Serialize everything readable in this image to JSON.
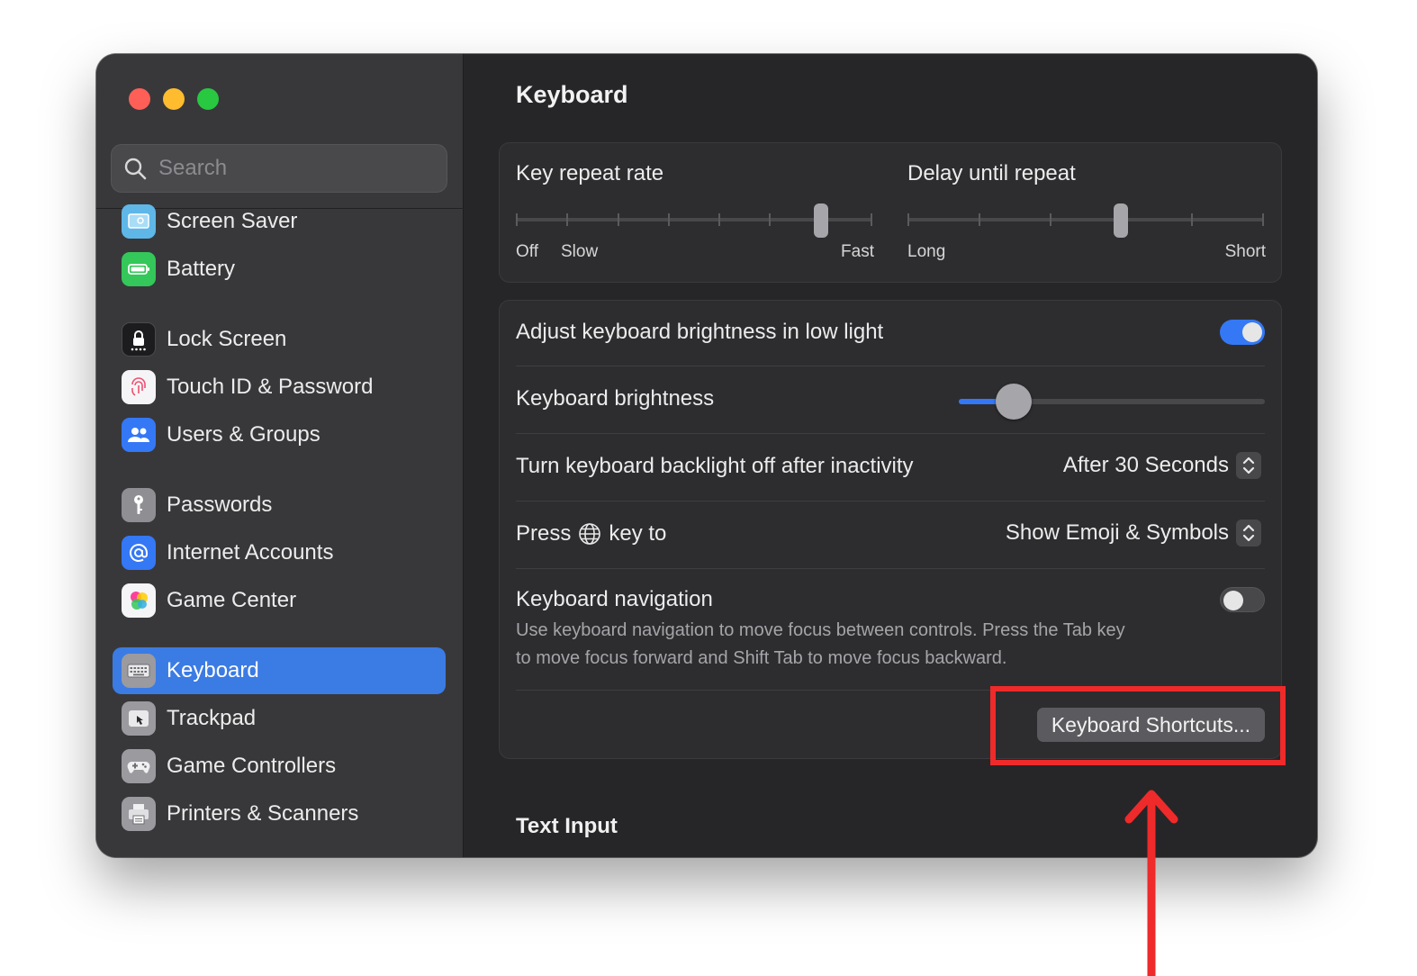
{
  "search": {
    "placeholder": "Search"
  },
  "sidebar": {
    "items": [
      {
        "label": "Screen Saver",
        "icon": "screen-saver-icon"
      },
      {
        "label": "Battery",
        "icon": "battery-icon"
      },
      {
        "label": "Lock Screen",
        "icon": "lock-icon"
      },
      {
        "label": "Touch ID & Password",
        "icon": "fingerprint-icon"
      },
      {
        "label": "Users & Groups",
        "icon": "users-icon"
      },
      {
        "label": "Passwords",
        "icon": "key-icon"
      },
      {
        "label": "Internet Accounts",
        "icon": "at-sign-icon"
      },
      {
        "label": "Game Center",
        "icon": "game-center-icon"
      },
      {
        "label": "Keyboard",
        "icon": "keyboard-icon",
        "selected": true
      },
      {
        "label": "Trackpad",
        "icon": "trackpad-icon"
      },
      {
        "label": "Game Controllers",
        "icon": "gamepad-icon"
      },
      {
        "label": "Printers & Scanners",
        "icon": "printer-icon"
      }
    ]
  },
  "main": {
    "title": "Keyboard",
    "key_repeat": {
      "label": "Key repeat rate",
      "caps": {
        "off": "Off",
        "slow": "Slow",
        "fast": "Fast"
      },
      "tick_count": 8,
      "selected_tick": 6
    },
    "delay_repeat": {
      "label": "Delay until repeat",
      "caps": {
        "long": "Long",
        "short": "Short"
      },
      "tick_count": 6,
      "selected_tick": 3
    },
    "adjust_brightness": {
      "label": "Adjust keyboard brightness in low light",
      "on": true
    },
    "keyboard_brightness": {
      "label": "Keyboard brightness",
      "level": 0.12
    },
    "backlight_off": {
      "label": "Turn keyboard backlight off after inactivity",
      "value": "After 30 Seconds"
    },
    "press_key": {
      "label_prefix": "Press",
      "label_suffix": "key to",
      "value": "Show Emoji & Symbols"
    },
    "keyboard_navigation": {
      "label": "Keyboard navigation",
      "on": false,
      "description_line1": "Use keyboard navigation to move focus between controls. Press the Tab key",
      "description_line2": "to move focus forward and Shift Tab to move focus backward."
    },
    "shortcuts_button": "Keyboard Shortcuts...",
    "text_input_title": "Text Input"
  },
  "colors": {
    "accent": "#3478f6",
    "selection": "#3b7be4",
    "annotation": "#ef2a2a"
  }
}
